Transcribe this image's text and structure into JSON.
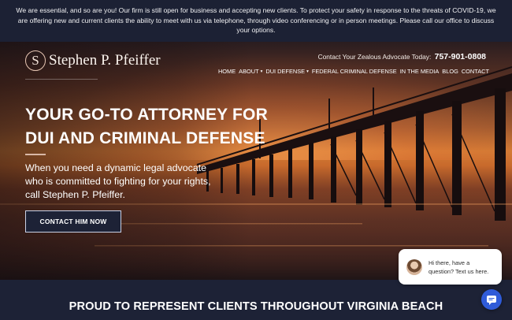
{
  "notice": {
    "text": "We are essential, and so are you! Our firm is still open for business and accepting new clients. To protect your safety in response to the threats of COVID-19, we are offering new and current clients the ability to meet with us via telephone, through video conferencing or in person meetings. Please call our office to discuss your options."
  },
  "header": {
    "logo_letter": "S",
    "logo_name": "Stephen P. Pfeiffer",
    "contact_label": "Contact Your Zealous Advocate Today:",
    "phone": "757-901-0808"
  },
  "nav": {
    "items": [
      {
        "label": "HOME",
        "dropdown": false
      },
      {
        "label": "ABOUT",
        "dropdown": true
      },
      {
        "label": "DUI DEFENSE",
        "dropdown": true
      },
      {
        "label": "FEDERAL CRIMINAL DEFENSE",
        "dropdown": false
      },
      {
        "label": "IN THE MEDIA",
        "dropdown": false
      },
      {
        "label": "BLOG",
        "dropdown": false
      },
      {
        "label": "CONTACT",
        "dropdown": false
      }
    ]
  },
  "hero": {
    "headline_line1": "YOUR GO-TO ATTORNEY FOR",
    "headline_line2": "DUI AND CRIMINAL DEFENSE",
    "subtext": "When you need a dynamic legal advocate who is committed to fighting for your rights, call Stephen P. Pfeiffer.",
    "cta_label": "CONTACT HIM NOW"
  },
  "section": {
    "title": "PROUD TO REPRESENT CLIENTS THROUGHOUT VIRGINIA BEACH"
  },
  "chat": {
    "line1": "Hi there, have a",
    "line2": "question? Text us here.",
    "button_icon": "chat-icon"
  },
  "colors": {
    "navy": "#1d2236",
    "chat_blue": "#2f5bd8"
  }
}
